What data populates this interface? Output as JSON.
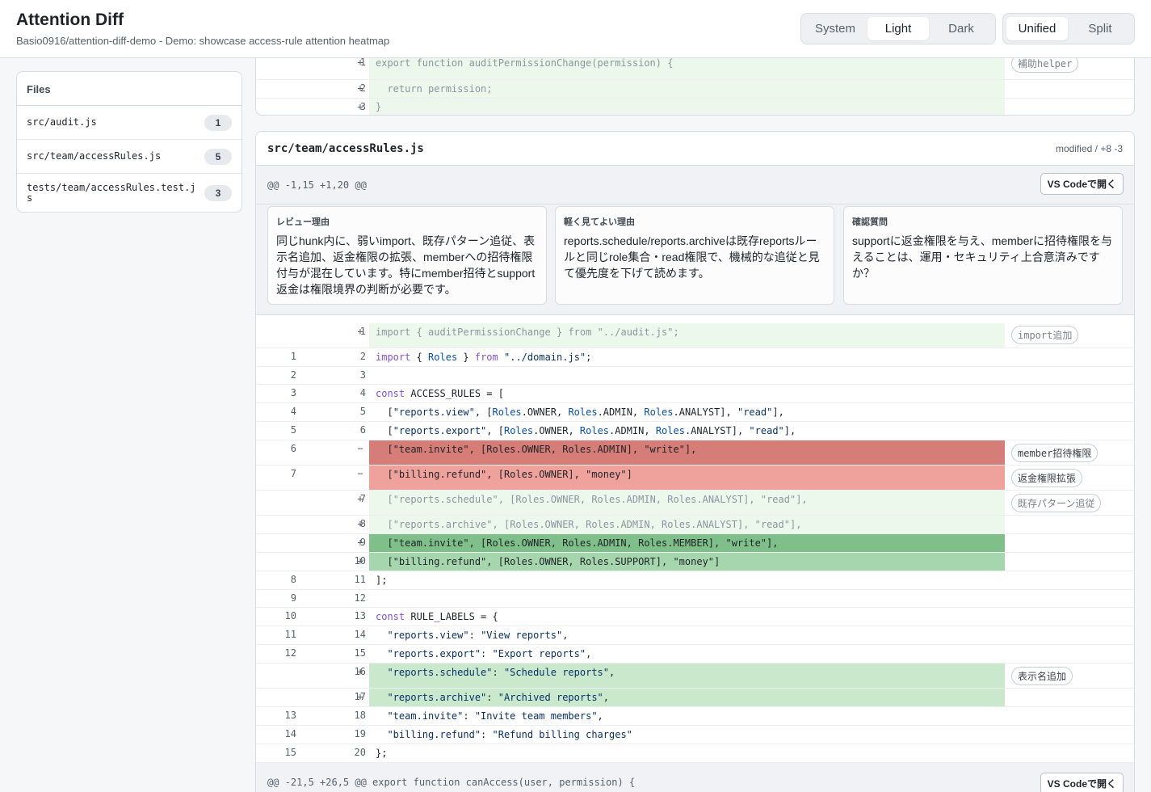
{
  "header": {
    "title": "Attention Diff",
    "subtitle": "Basio0916/attention-diff-demo - Demo: showcase access-rule attention heatmap",
    "theme_options": [
      "System",
      "Light",
      "Dark"
    ],
    "theme_selected": "Light",
    "view_options": [
      "Unified",
      "Split"
    ],
    "view_selected": "Unified"
  },
  "sidebar": {
    "heading": "Files",
    "files": [
      {
        "name": "src/audit.js",
        "count": "1"
      },
      {
        "name": "src/team/accessRules.js",
        "count": "5"
      },
      {
        "name": "tests/team/accessRules.test.js",
        "count": "3"
      }
    ]
  },
  "prev_file": {
    "lines": [
      {
        "new": "1",
        "marker": "+",
        "code": "export function auditPermissionChange(permission) {"
      },
      {
        "new": "2",
        "marker": "+",
        "code": "  return permission;"
      },
      {
        "new": "3",
        "marker": "+",
        "code": "}"
      }
    ],
    "tag": "補助helper"
  },
  "file": {
    "path": "src/team/accessRules.js",
    "meta": "modified / +8 -3",
    "hunk1": "@@ -1,15 +1,20 @@",
    "hunk2": "@@ -21,5 +26,5 @@ export function canAccess(user, permission) {",
    "open_button": "VS Codeで開く",
    "notes": [
      {
        "title": "レビュー理由",
        "body": "同じhunk内に、弱いimport、既存パターン追従、表示名追加、返金権限の拡張、memberへの招待権限付与が混在しています。特にmember招待とsupport返金は権限境界の判断が必要です。"
      },
      {
        "title": "軽く見てよい理由",
        "body": "reports.schedule/reports.archiveは既存reportsルールと同じrole集合・read権限で、機械的な追従と見て優先度を下げて読めます。"
      },
      {
        "title": "確認質問",
        "body": "supportに返金権限を与え、memberに招待権限を与えることは、運用・セキュリティ上合意済みですか？"
      }
    ],
    "tags": {
      "import": "import追加",
      "invite": "member招待権限",
      "refund": "返金権限拡張",
      "pattern": "既存パターン追従",
      "label": "表示名追加"
    }
  },
  "colors": {
    "add_soft": "#edf8ed",
    "add_mid": "#c9e8cc",
    "add_strong": "#7fc08a",
    "del_strong": "#d67d77",
    "del_mid": "#efa19c"
  }
}
